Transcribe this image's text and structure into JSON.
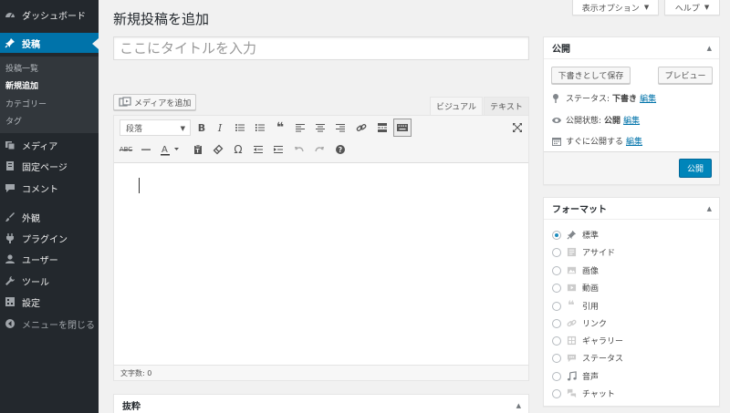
{
  "sidebar": {
    "items": [
      {
        "label": "ダッシュボード",
        "icon": "dashboard-icon"
      },
      {
        "label": "投稿",
        "icon": "pin-icon"
      },
      {
        "label": "メディア",
        "icon": "media-icon"
      },
      {
        "label": "固定ページ",
        "icon": "page-icon"
      },
      {
        "label": "コメント",
        "icon": "comment-icon"
      },
      {
        "label": "外観",
        "icon": "brush-icon"
      },
      {
        "label": "プラグイン",
        "icon": "plugin-icon"
      },
      {
        "label": "ユーザー",
        "icon": "user-icon"
      },
      {
        "label": "ツール",
        "icon": "wrench-icon"
      },
      {
        "label": "設定",
        "icon": "settings-icon"
      },
      {
        "label": "メニューを閉じる",
        "icon": "collapse-icon"
      }
    ],
    "submenu": [
      "投稿一覧",
      "新規追加",
      "カテゴリー",
      "タグ"
    ]
  },
  "top_tabs": {
    "screen_options": "表示オプション",
    "help": "ヘルプ"
  },
  "page_title": "新規投稿を追加",
  "title_input": {
    "placeholder": "ここにタイトルを入力",
    "value": ""
  },
  "media_button": "メディアを追加",
  "editor_tabs": {
    "visual": "ビジュアル",
    "text": "テキスト"
  },
  "format_select": "段落",
  "word_count": "文字数: 0",
  "excerpt_title": "抜粋",
  "publish": {
    "title": "公開",
    "save_draft": "下書きとして保存",
    "preview": "プレビュー",
    "status_label": "ステータス:",
    "status_value": "下書き",
    "visibility_label": "公開状態:",
    "visibility_value": "公開",
    "schedule_label": "すぐに公開する",
    "edit_link": "編集",
    "publish_button": "公開"
  },
  "format_box": {
    "title": "フォーマット",
    "options": [
      {
        "label": "標準",
        "icon": "pin-icon",
        "checked": true
      },
      {
        "label": "アサイド",
        "icon": "aside-icon",
        "checked": false
      },
      {
        "label": "画像",
        "icon": "image-icon",
        "checked": false
      },
      {
        "label": "動画",
        "icon": "video-icon",
        "checked": false
      },
      {
        "label": "引用",
        "icon": "quote-icon",
        "checked": false
      },
      {
        "label": "リンク",
        "icon": "link-icon",
        "checked": false
      },
      {
        "label": "ギャラリー",
        "icon": "gallery-icon",
        "checked": false
      },
      {
        "label": "ステータス",
        "icon": "status-icon",
        "checked": false
      },
      {
        "label": "音声",
        "icon": "audio-icon",
        "checked": false
      },
      {
        "label": "チャット",
        "icon": "chat-icon",
        "checked": false
      }
    ]
  },
  "colors": {
    "sidebar_bg": "#23282d",
    "accent": "#0073aa",
    "publish_button": "#0085ba"
  }
}
